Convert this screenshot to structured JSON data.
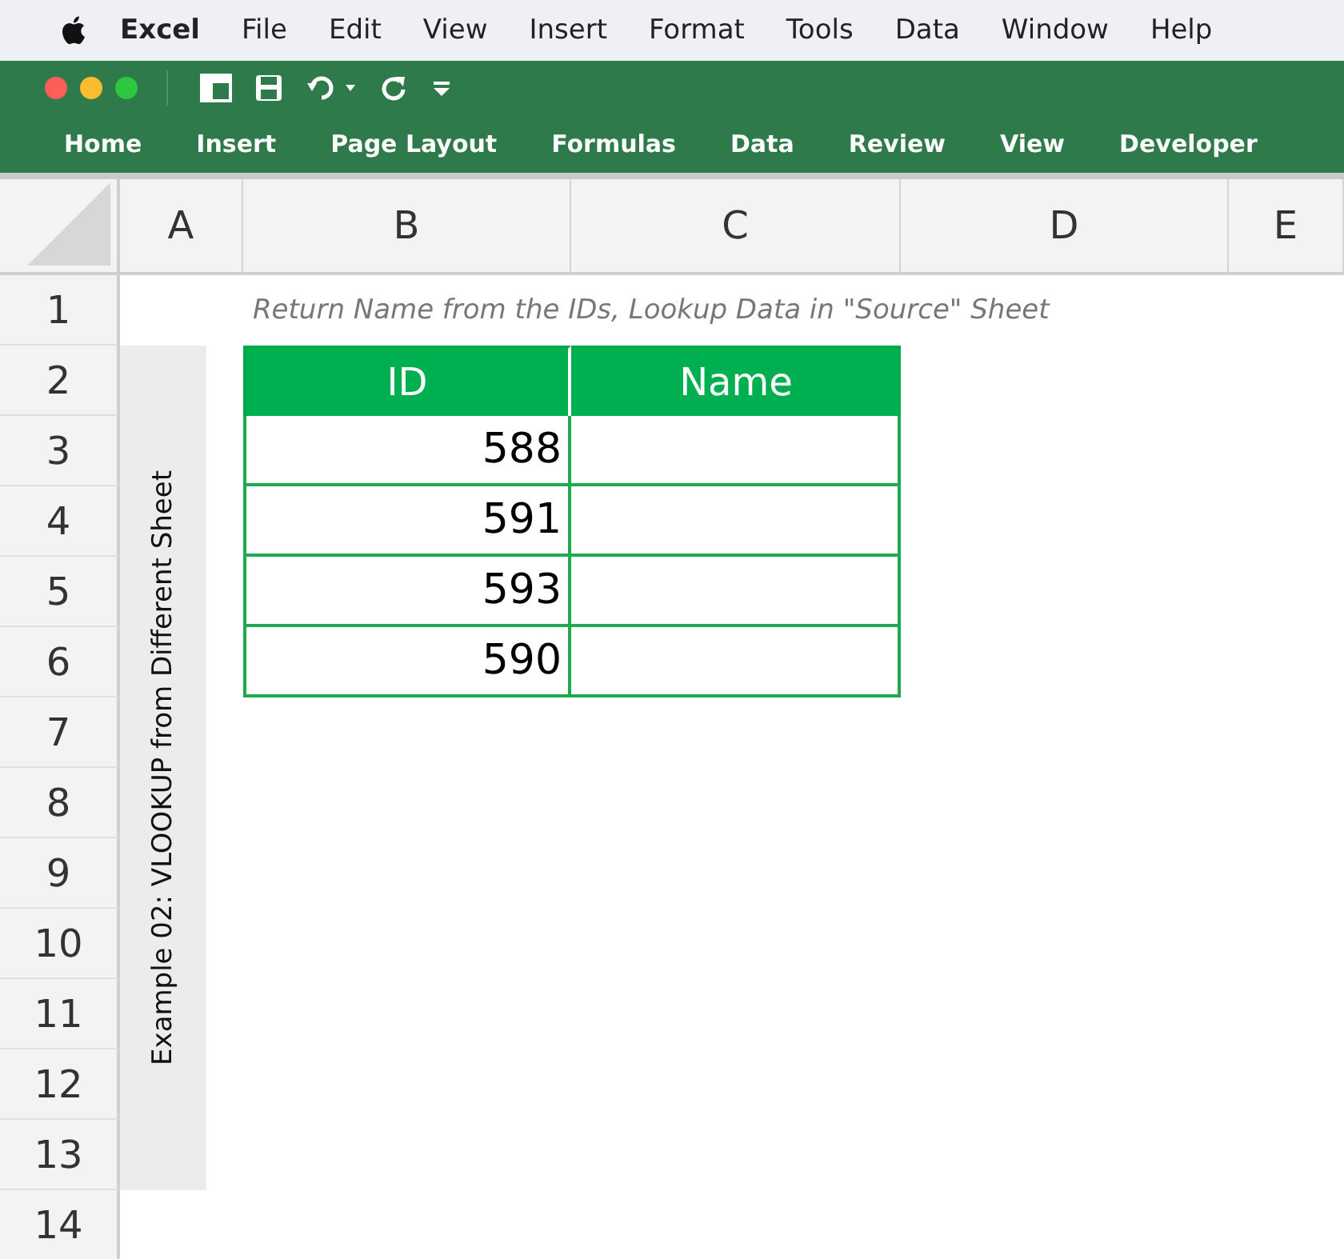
{
  "menu_bar": {
    "app": "Excel",
    "items": [
      "File",
      "Edit",
      "View",
      "Insert",
      "Format",
      "Tools",
      "Data",
      "Window",
      "Help"
    ]
  },
  "ribbon_tabs": [
    "Home",
    "Insert",
    "Page Layout",
    "Formulas",
    "Data",
    "Review",
    "View",
    "Developer"
  ],
  "sheet": {
    "columns": [
      "A",
      "B",
      "C",
      "D",
      "E"
    ],
    "rows": [
      "1",
      "2",
      "3",
      "4",
      "5",
      "6",
      "7",
      "8",
      "9",
      "10",
      "11",
      "12",
      "13",
      "14"
    ],
    "note": "Return Name from the IDs, Lookup Data in \"Source\" Sheet",
    "side_label": "Example 02: VLOOKUP from Different Sheet",
    "table": {
      "columns": [
        "ID",
        "Name"
      ],
      "rows": [
        {
          "id": "588"
        },
        {
          "id": "591"
        },
        {
          "id": "593"
        },
        {
          "id": "590"
        }
      ]
    }
  }
}
